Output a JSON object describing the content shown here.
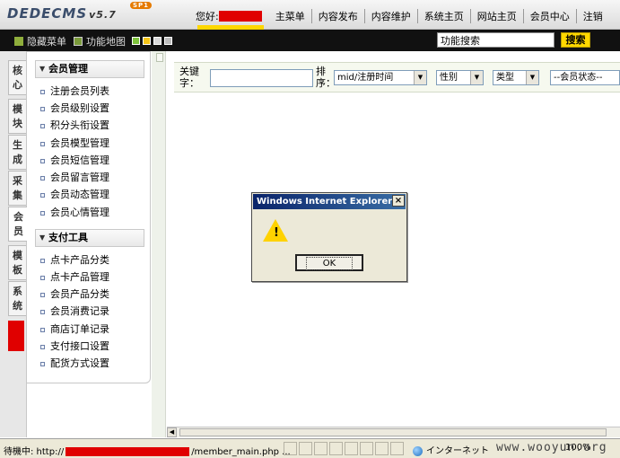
{
  "header": {
    "logo_text": "DEDECMS",
    "logo_version": "v5.7",
    "logo_badge": "SP1",
    "greeting": "您好:",
    "nav_items": [
      "主菜单",
      "内容发布",
      "内容维护",
      "系统主页",
      "网站主页",
      "会员中心",
      "注销"
    ]
  },
  "toolbar": {
    "hide_menu": "隐藏菜单",
    "function_map": "功能地图",
    "search_value": "功能搜索",
    "search_button": "搜索",
    "skin_colors": [
      "#7ec33c",
      "#f5c518",
      "#d9d9d9",
      "#bcbcbc"
    ]
  },
  "vtabs": [
    "核心",
    "模块",
    "生成",
    "采集",
    "会员",
    "模板",
    "系统"
  ],
  "menu": {
    "section1": {
      "title": "会员管理",
      "items": [
        "注册会员列表",
        "会员级别设置",
        "积分头衔设置",
        "会员模型管理",
        "会员短信管理",
        "会员留言管理",
        "会员动态管理",
        "会员心情管理"
      ]
    },
    "section2": {
      "title": "支付工具",
      "items": [
        "点卡产品分类",
        "点卡产品管理",
        "会员产品分类",
        "会员消费记录",
        "商店订单记录",
        "支付接口设置",
        "配货方式设置"
      ]
    }
  },
  "filter": {
    "keyword_label": "关键字：",
    "sort_label": "排序：",
    "sort_value": "mid/注册时间",
    "gender_value": "性别",
    "type_value": "类型",
    "status_value": "--会员状态--"
  },
  "dialog": {
    "title": "Windows Internet Explorer",
    "ok_label": "OK"
  },
  "status": {
    "prefix": "待機中: http://",
    "suffix": "/member_main.php ...",
    "zone": "インターネット",
    "zoom": "100%",
    "watermark": "www.wooyun.org"
  },
  "colors": {
    "redaction": "#e00000",
    "search_button": "#ffd800",
    "toolbar_bg": "#111111"
  }
}
